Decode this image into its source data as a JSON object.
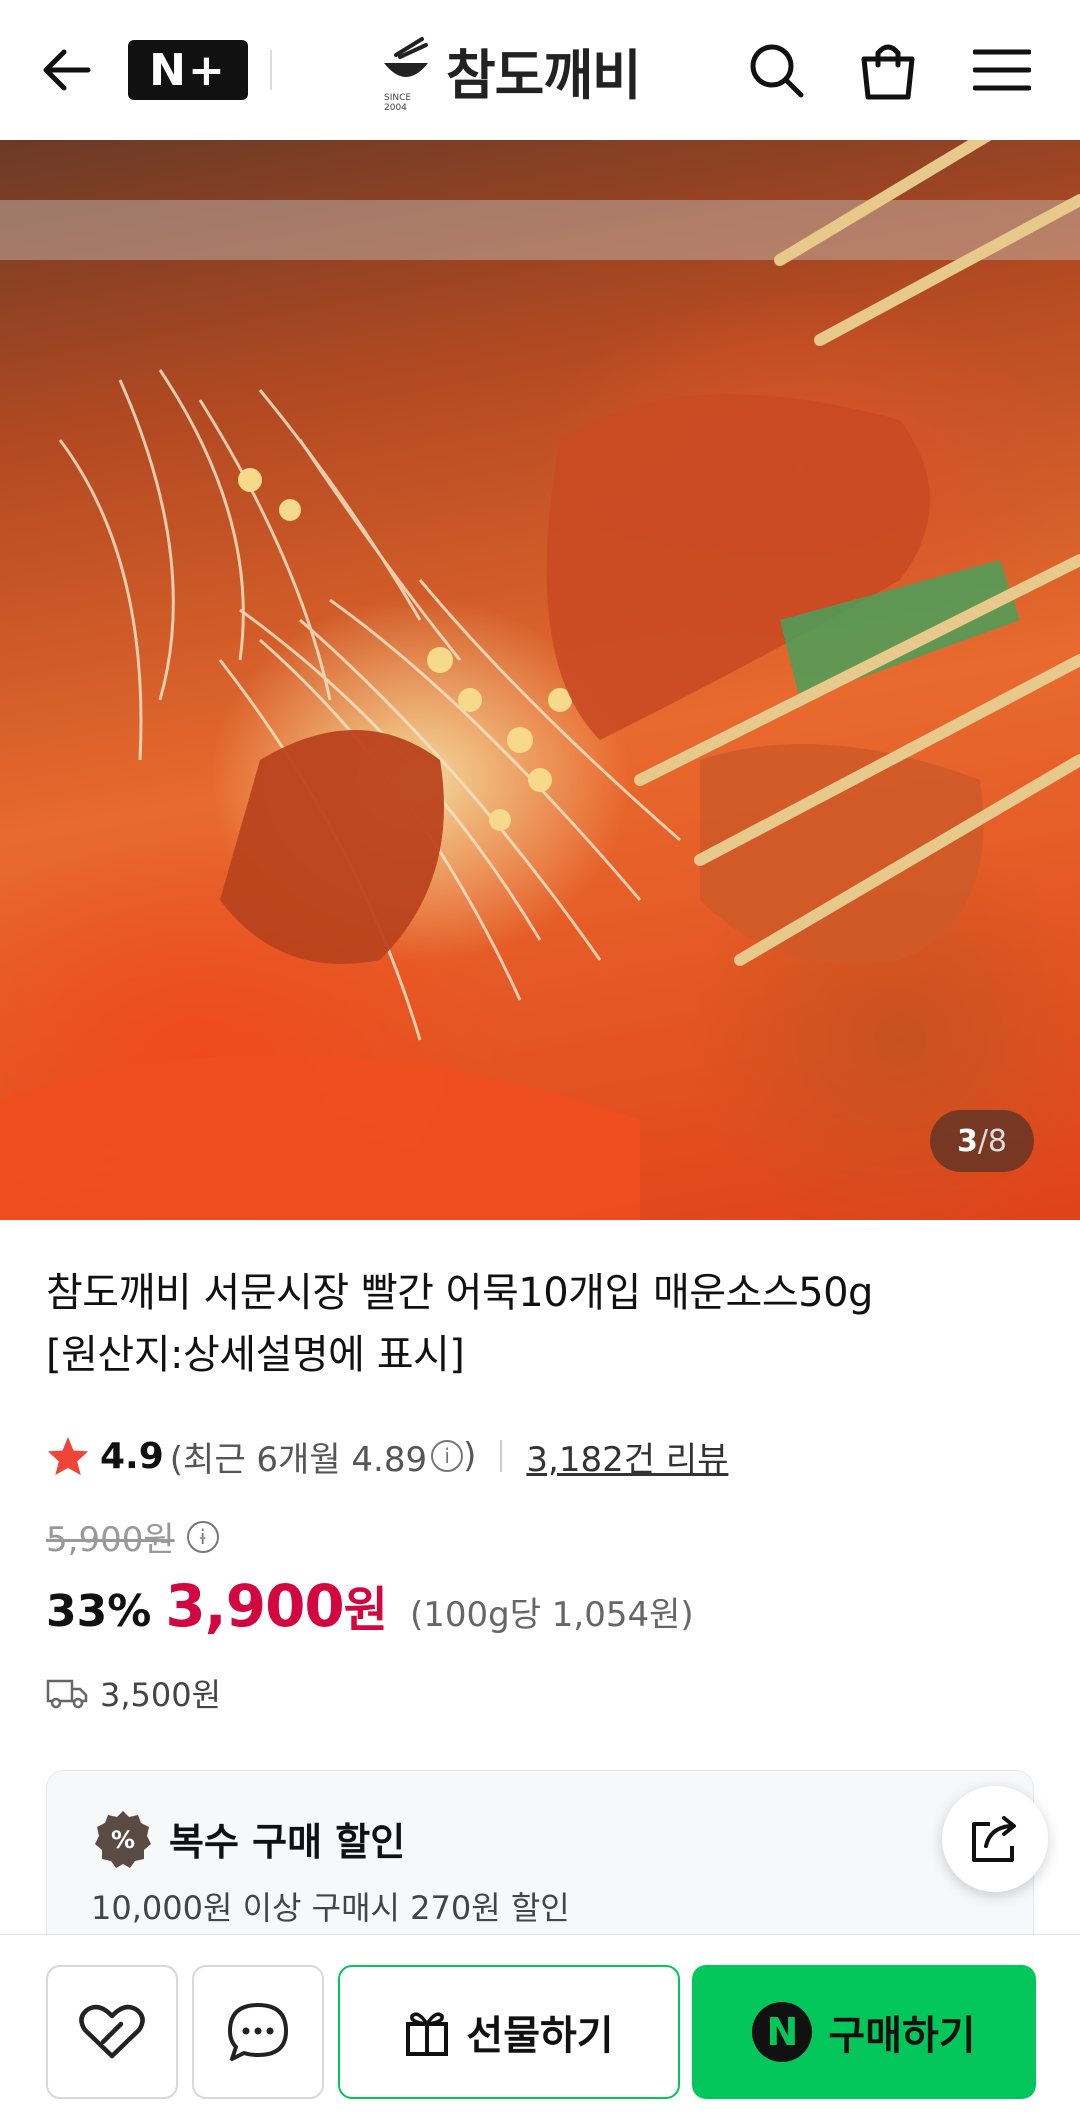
{
  "header": {
    "badge": "N+",
    "brand": "참도깨비",
    "brand_since": "SINCE 2004"
  },
  "gallery": {
    "current": "3",
    "total": "/8"
  },
  "product": {
    "title_line1": "참도깨비 서문시장 빨간 어묵10개입 매운소스50g",
    "title_line2": "[원산지:상세설명에 표시]",
    "rating": "4.9",
    "recent_rating_prefix": "(최근 6개월 4.89",
    "recent_rating_suffix": ")",
    "reviews": "3,182건 리뷰",
    "original_price": "5,900원",
    "discount": "33%",
    "price": "3,900",
    "price_unit": "원",
    "unit_price": "(100g당 1,054원)",
    "shipping": "3,500원"
  },
  "promo": {
    "title": "복수 구매 할인",
    "description": "10,000원 이상 구매시 270원 할인"
  },
  "actions": {
    "gift": "선물하기",
    "buy": "구매하기",
    "buy_badge": "N"
  },
  "colors": {
    "price_red": "#d3073f",
    "naver_green": "#03c75a",
    "star_red": "#f04438"
  }
}
